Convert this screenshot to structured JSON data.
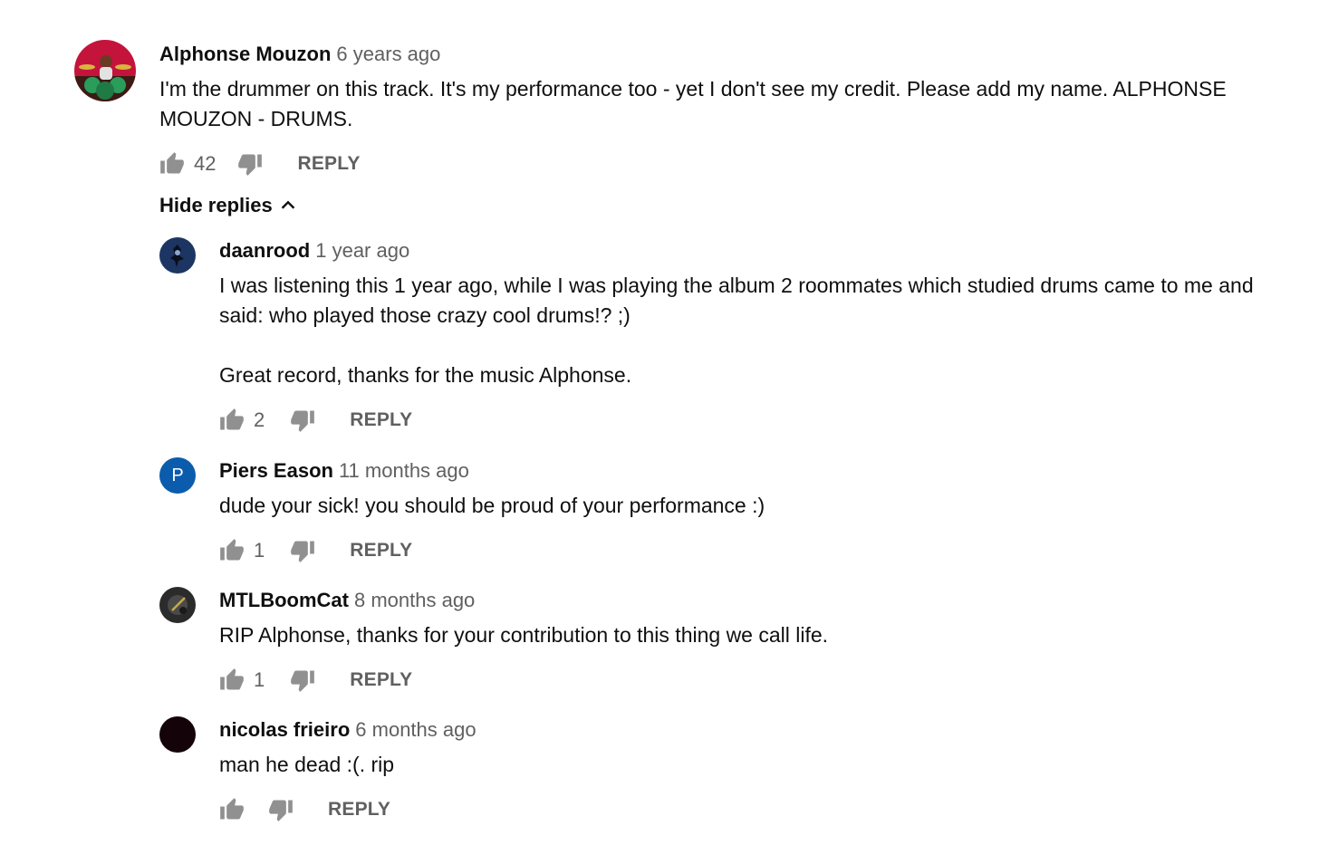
{
  "top_comment": {
    "author": "Alphonse Mouzon",
    "time": "6 years ago",
    "text": "I'm the drummer on this track. It's my performance too - yet I don't see my credit. Please add my name. ALPHONSE MOUZON - DRUMS.",
    "likes": "42",
    "reply_label": "REPLY",
    "avatar_icon": "drummer-photo"
  },
  "hide_replies_label": "Hide replies",
  "replies": [
    {
      "author": "daanrood",
      "time": "1 year ago",
      "text": "I was listening this 1 year ago, while I was playing the album 2 roommates which studied drums came to me and said: who played those crazy cool drums!? ;)\n\nGreat record, thanks for the music Alphonse.",
      "likes": "2",
      "reply_label": "REPLY",
      "avatar_color": "#1d3563"
    },
    {
      "author": "Piers Eason",
      "time": "11 months ago",
      "text": "dude your sick! you should be proud of your performance :)",
      "likes": "1",
      "reply_label": "REPLY",
      "avatar_letter": "P",
      "avatar_color": "#0b5cad"
    },
    {
      "author": "MTLBoomCat",
      "time": "8 months ago",
      "text": "RIP Alphonse, thanks for your contribution to this thing we call life.",
      "likes": "1",
      "reply_label": "REPLY",
      "avatar_color": "#2b2b2b"
    },
    {
      "author": "nicolas frieiro",
      "time": "6 months ago",
      "text": "man he dead :(. rip",
      "likes": "",
      "reply_label": "REPLY",
      "avatar_color": "#14040a"
    }
  ],
  "colors": {
    "text": "#0f0f0f",
    "secondary": "#606060",
    "icon": "#909090"
  }
}
